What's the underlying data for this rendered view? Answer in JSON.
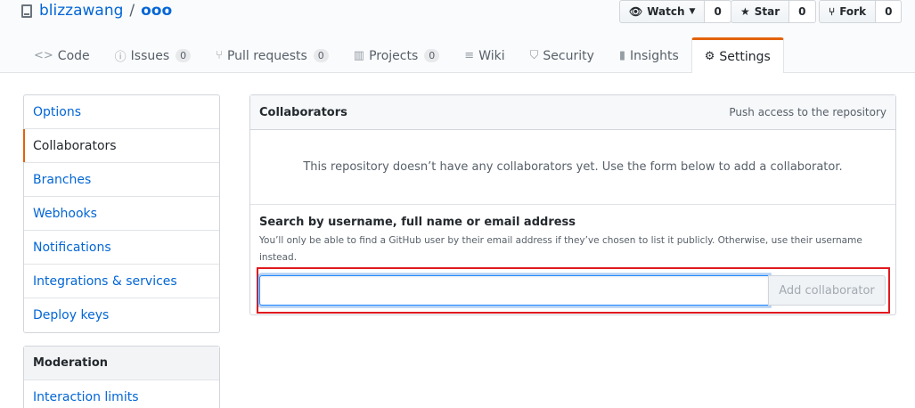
{
  "repo": {
    "owner": "blizzawang",
    "separator": "/",
    "name": "ooo"
  },
  "actions": {
    "watch": {
      "label": "Watch",
      "count": "0"
    },
    "star": {
      "label": "Star",
      "count": "0"
    },
    "fork": {
      "label": "Fork",
      "count": "0"
    }
  },
  "tabs": [
    {
      "label": "Code",
      "icon": "<>",
      "counter": ""
    },
    {
      "label": "Issues",
      "icon": "ⓘ",
      "counter": "0"
    },
    {
      "label": "Pull requests",
      "icon": "⑂",
      "counter": "0"
    },
    {
      "label": "Projects",
      "icon": "▥",
      "counter": "0"
    },
    {
      "label": "Wiki",
      "icon": "≡",
      "counter": ""
    },
    {
      "label": "Security",
      "icon": "⛉",
      "counter": ""
    },
    {
      "label": "Insights",
      "icon": "▮",
      "counter": ""
    },
    {
      "label": "Settings",
      "icon": "⚙",
      "counter": ""
    }
  ],
  "sidebar": {
    "items": [
      {
        "label": "Options"
      },
      {
        "label": "Collaborators"
      },
      {
        "label": "Branches"
      },
      {
        "label": "Webhooks"
      },
      {
        "label": "Notifications"
      },
      {
        "label": "Integrations & services"
      },
      {
        "label": "Deploy keys"
      }
    ],
    "moderation": {
      "heading": "Moderation",
      "items": [
        {
          "label": "Interaction limits"
        }
      ]
    }
  },
  "collaborators": {
    "title": "Collaborators",
    "meta": "Push access to the repository",
    "blankslate": "This repository doesn’t have any collaborators yet. Use the form below to add a collaborator.",
    "search_label": "Search by username, full name or email address",
    "note": "You’ll only be able to find a GitHub user by their email address if they’ve chosen to list it publicly. Otherwise, use their username instead.",
    "input_value": "",
    "add_button": "Add collaborator"
  },
  "colors": {
    "accent": "#e36209",
    "link": "#0366d6",
    "highlight": "#e0191e"
  }
}
